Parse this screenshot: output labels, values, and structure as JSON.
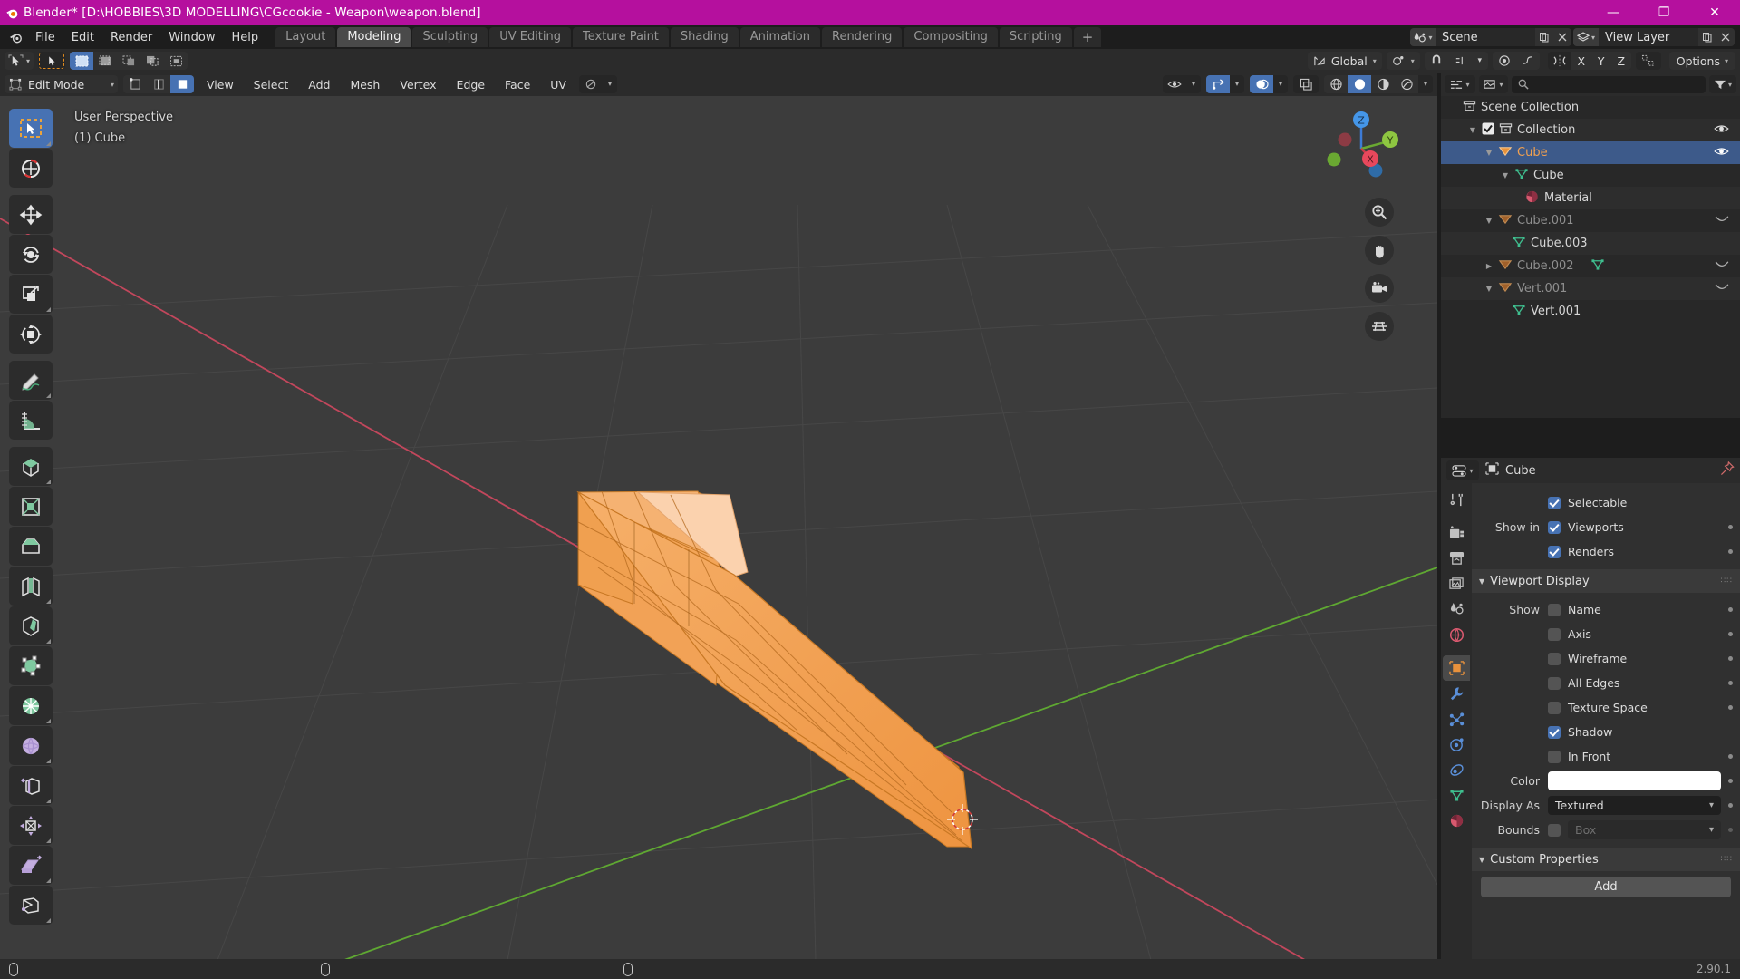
{
  "window": {
    "title": "Blender* [D:\\HOBBIES\\3D MODELLING\\CGcookie - Weapon\\weapon.blend]",
    "minimize": "—",
    "maximize": "❐",
    "close": "✕",
    "accent_color": "#b5109e"
  },
  "menus": [
    "File",
    "Edit",
    "Render",
    "Window",
    "Help"
  ],
  "workspace_tabs": [
    {
      "label": "Layout",
      "active": false
    },
    {
      "label": "Modeling",
      "active": true
    },
    {
      "label": "Sculpting",
      "active": false
    },
    {
      "label": "UV Editing",
      "active": false
    },
    {
      "label": "Texture Paint",
      "active": false
    },
    {
      "label": "Shading",
      "active": false
    },
    {
      "label": "Animation",
      "active": false
    },
    {
      "label": "Rendering",
      "active": false
    },
    {
      "label": "Compositing",
      "active": false
    },
    {
      "label": "Scripting",
      "active": false
    }
  ],
  "workspace_add": "+",
  "topbar_right": {
    "scene_name": "Scene",
    "view_layer_name": "View Layer"
  },
  "tool_settings": {
    "orientation": "Global",
    "axis_buttons": [
      "X",
      "Y",
      "Z"
    ],
    "options_label": "Options"
  },
  "viewport_header": {
    "mode": "Edit Mode",
    "menus": [
      "View",
      "Select",
      "Add",
      "Mesh",
      "Vertex",
      "Edge",
      "Face",
      "UV"
    ]
  },
  "viewport": {
    "perspective_line1": "User Perspective",
    "perspective_line2": "(1) Cube",
    "gizmo_axes": [
      "X",
      "Y",
      "Z"
    ],
    "background_color": "#3c3c3c",
    "mesh_color": "#f0a050"
  },
  "toolbar_tools": [
    {
      "name": "tweak-select-box-tool",
      "active": true
    },
    {
      "name": "cursor-tool",
      "active": false
    },
    {
      "name": "move-tool",
      "active": false
    },
    {
      "name": "rotate-tool",
      "active": false
    },
    {
      "name": "scale-tool",
      "active": false
    },
    {
      "name": "transform-tool",
      "active": false
    },
    {
      "name": "annotate-tool",
      "active": false
    },
    {
      "name": "measure-tool",
      "active": false
    },
    {
      "name": "extrude-region-tool",
      "active": false
    },
    {
      "name": "inset-faces-tool",
      "active": false
    },
    {
      "name": "bevel-tool",
      "active": false
    },
    {
      "name": "loop-cut-tool",
      "active": false
    },
    {
      "name": "knife-tool",
      "active": false
    },
    {
      "name": "poly-build-tool",
      "active": false
    },
    {
      "name": "spin-tool",
      "active": false
    },
    {
      "name": "smooth-tool",
      "active": false
    },
    {
      "name": "edge-slide-tool",
      "active": false
    },
    {
      "name": "shrink-fatten-tool",
      "active": false
    },
    {
      "name": "shear-tool",
      "active": false
    },
    {
      "name": "rip-region-tool",
      "active": false
    }
  ],
  "outliner": {
    "search_placeholder": "",
    "rows": [
      {
        "indent": 0,
        "label": "Scene Collection",
        "icon": "collection-icon",
        "triangle": "",
        "dim": false,
        "selected": false,
        "eye": false,
        "checkbox": false
      },
      {
        "indent": 1,
        "label": "Collection",
        "icon": "collection-icon",
        "triangle": "▼",
        "dim": false,
        "selected": false,
        "eye": true,
        "checkbox": true
      },
      {
        "indent": 2,
        "label": "Cube",
        "icon": "object-mesh-icon",
        "triangle": "▼",
        "dim": false,
        "selected": true,
        "eye": true,
        "checkbox": false
      },
      {
        "indent": 3,
        "label": "Cube",
        "icon": "mesh-data-icon",
        "triangle": "▼",
        "dim": false,
        "selected": false,
        "eye": false,
        "checkbox": false
      },
      {
        "indent": 4,
        "label": "Material",
        "icon": "material-icon",
        "triangle": "",
        "dim": false,
        "selected": false,
        "eye": false,
        "checkbox": false
      },
      {
        "indent": 2,
        "label": "Cube.001",
        "icon": "object-mesh-icon",
        "triangle": "▼",
        "dim": true,
        "selected": false,
        "eye": false,
        "checkbox": false
      },
      {
        "indent": 3,
        "label": "Cube.003",
        "icon": "mesh-data-icon",
        "triangle": "",
        "dim": false,
        "selected": false,
        "eye": false,
        "checkbox": false
      },
      {
        "indent": 2,
        "label": "Cube.002",
        "icon": "object-mesh-icon",
        "triangle": "▶",
        "dim": true,
        "selected": false,
        "eye": false,
        "checkbox": false
      },
      {
        "indent": 2,
        "label": "Vert.001",
        "icon": "object-mesh-icon",
        "triangle": "▼",
        "dim": true,
        "selected": false,
        "eye": false,
        "checkbox": false
      },
      {
        "indent": 3,
        "label": "Vert.001",
        "icon": "mesh-data-icon",
        "triangle": "",
        "dim": false,
        "selected": false,
        "eye": false,
        "checkbox": false
      }
    ]
  },
  "properties": {
    "breadcrumb_object": "Cube",
    "tabs": [
      {
        "name": "tool-tab",
        "active": false
      },
      {
        "name": "render-tab",
        "active": false
      },
      {
        "name": "output-tab",
        "active": false
      },
      {
        "name": "view-layer-tab",
        "active": false
      },
      {
        "name": "scene-tab",
        "active": false
      },
      {
        "name": "world-tab",
        "active": false
      },
      {
        "name": "object-tab",
        "active": true
      },
      {
        "name": "modifier-tab",
        "active": false
      },
      {
        "name": "particles-tab",
        "active": false
      },
      {
        "name": "physics-tab",
        "active": false
      },
      {
        "name": "constraints-tab",
        "active": false
      },
      {
        "name": "object-data-tab",
        "active": false
      },
      {
        "name": "material-tab",
        "active": false
      }
    ],
    "rows": [
      {
        "label": "",
        "text": "Selectable",
        "checked": true,
        "dot": false
      },
      {
        "label": "Show in",
        "text": "Viewports",
        "checked": true,
        "dot": true
      },
      {
        "label": "",
        "text": "Renders",
        "checked": true,
        "dot": true
      }
    ],
    "viewport_display": {
      "title": "Viewport Display",
      "rows": [
        {
          "label": "Show",
          "text": "Name",
          "checked": false,
          "dot": true
        },
        {
          "label": "",
          "text": "Axis",
          "checked": false,
          "dot": true
        },
        {
          "label": "",
          "text": "Wireframe",
          "checked": false,
          "dot": true
        },
        {
          "label": "",
          "text": "All Edges",
          "checked": false,
          "dot": true
        },
        {
          "label": "",
          "text": "Texture Space",
          "checked": false,
          "dot": true
        },
        {
          "label": "",
          "text": "Shadow",
          "checked": true,
          "dot": false
        },
        {
          "label": "",
          "text": "In Front",
          "checked": false,
          "dot": true
        }
      ],
      "color_label": "Color",
      "color_value": "#ffffff",
      "display_as_label": "Display As",
      "display_as_value": "Textured",
      "bounds_label": "Bounds",
      "bounds_checked": false,
      "bounds_value": "Box"
    },
    "custom_properties": {
      "title": "Custom Properties",
      "add_label": "Add"
    }
  },
  "statusbar": {
    "hints": [
      "",
      "",
      ""
    ],
    "version": "2.90.1"
  }
}
